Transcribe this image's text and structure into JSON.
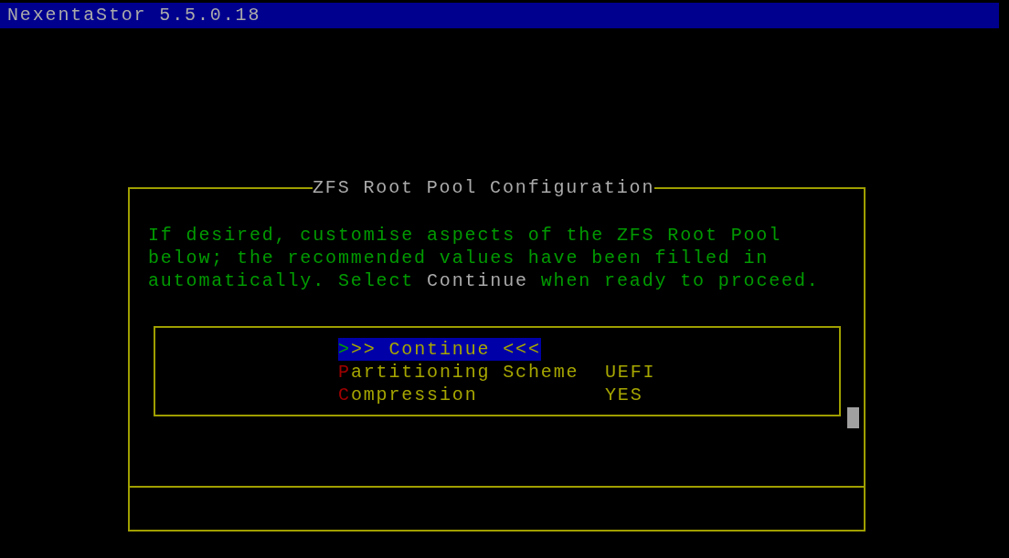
{
  "title_bar": {
    "title": "NexentaStor 5.5.0.18"
  },
  "dialog": {
    "title": "ZFS Root Pool Configuration",
    "message": "If desired, customise aspects of the ZFS Root Pool below; the recommended values have been filled in automatically. Select **Continue** when ready to proceed.",
    "menu": [
      {
        "label": ">>> Continue <<<",
        "selected": true
      },
      {
        "label": "Partitioning Scheme",
        "value": "UEFI",
        "selected": false
      },
      {
        "label": "Compression",
        "value": "YES",
        "selected": false
      }
    ]
  }
}
